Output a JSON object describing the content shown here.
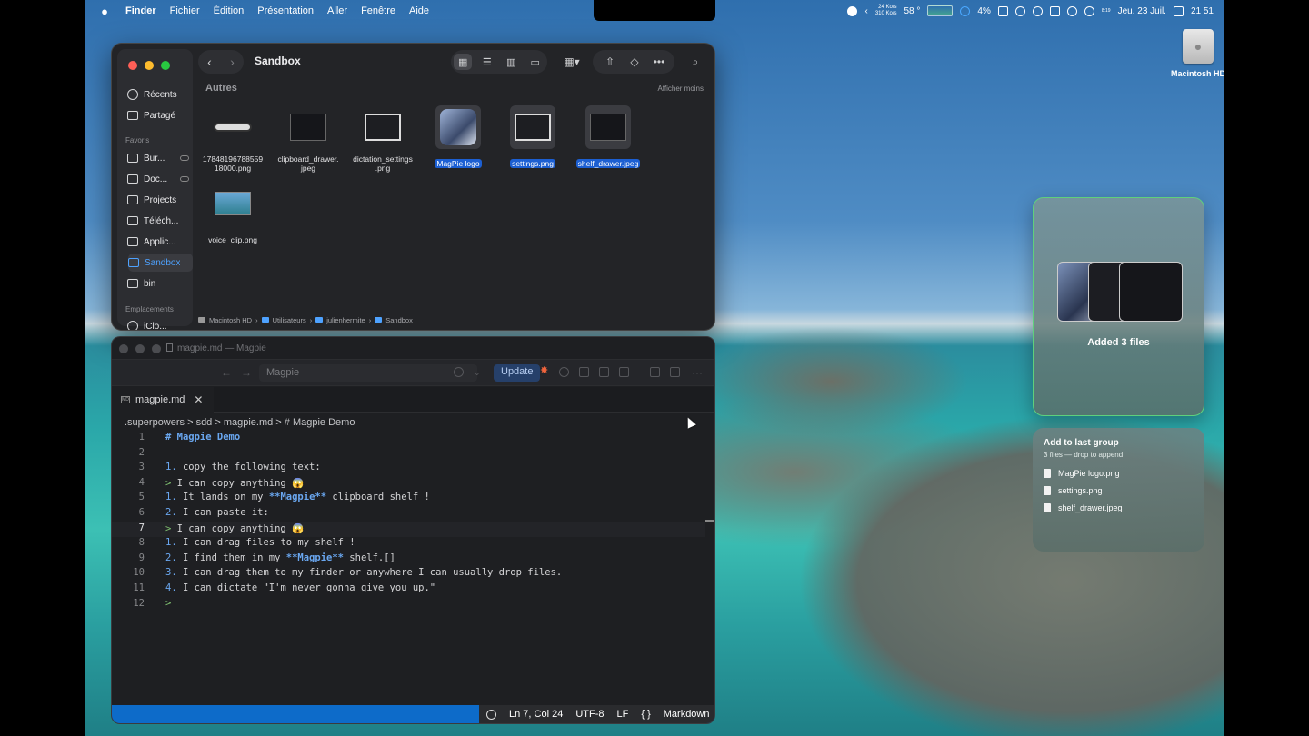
{
  "menubar": {
    "app": "Finder",
    "items": [
      "Fichier",
      "Édition",
      "Présentation",
      "Aller",
      "Fenêtre",
      "Aide"
    ],
    "net_up": "24 Ko/s",
    "net_down": "310 Ko/s",
    "temp": "58 °",
    "battery": "4%",
    "mini_time": "8:19",
    "date": "Jeu. 23 Juil.",
    "time": "21 51"
  },
  "desktop": {
    "drive_label": "Macintosh HD"
  },
  "finder": {
    "title": "Sandbox",
    "sidebar": {
      "items_top": [
        "Récents",
        "Partagé"
      ],
      "section_favoris": "Favoris",
      "favoris": [
        "Bur...",
        "Doc...",
        "Projects",
        "Téléch...",
        "Applic...",
        "Sandbox",
        "bin"
      ],
      "section_emplacements": "Emplacements",
      "emplacements": [
        "iClo..."
      ]
    },
    "group_header": "Autres",
    "show_less": "Afficher moins",
    "files": [
      {
        "name": "17848196788559 18000.png",
        "thumb": "pill",
        "selected": false
      },
      {
        "name": "clipboard_drawer. jpeg",
        "thumb": "dark-shot",
        "selected": false
      },
      {
        "name": "dictation_settings .png",
        "thumb": "light-shot",
        "selected": false
      },
      {
        "name": "MagPie logo",
        "thumb": "logo",
        "selected": true
      },
      {
        "name": "settings.png",
        "thumb": "light-shot",
        "selected": true
      },
      {
        "name": "shelf_drawer.jpeg",
        "thumb": "dark-shot",
        "selected": true
      },
      {
        "name": "voice_clip.png",
        "thumb": "voice",
        "selected": false
      }
    ],
    "path": [
      "Macintosh HD",
      "Utilisateurs",
      "julienhermite",
      "Sandbox"
    ]
  },
  "editor": {
    "window_title": "magpie.md — Magpie",
    "search_text": "Magpie",
    "update_label": "Update",
    "tab_label": "magpie.md",
    "tab_badge": "MD",
    "breadcrumb": ".superpowers > sdd > magpie.md > # Magpie Demo",
    "current_line": 7,
    "lines": [
      "# Magpie Demo",
      "",
      "1. copy the following text:",
      "> I can copy anything 😱",
      "1. It lands on my **Magpie** clipboard shelf !",
      "2. I can paste it:",
      "> I can copy anything 😱",
      "1. I can drag files to my shelf !",
      "2. I find them in my **Magpie** shelf.[]",
      "3. I can drag them to my finder or anywhere I can usually drop files.",
      "4. I can dictate \"I'm never gonna give you up.\"",
      ">"
    ],
    "status": {
      "position": "Ln 7, Col 24",
      "encoding": "UTF-8",
      "eol": "LF",
      "language": "Markdown"
    }
  },
  "shelf": {
    "label": "Added 3 files",
    "drop_title": "Add to last group",
    "drop_sub": "3 files — drop to append",
    "drop_files": [
      "MagPie logo.png",
      "settings.png",
      "shelf_drawer.jpeg"
    ]
  },
  "colors": {
    "accent": "#1c5fd2",
    "shelf_border": "#5fd07c",
    "statusbar": "#0d6bc9"
  }
}
